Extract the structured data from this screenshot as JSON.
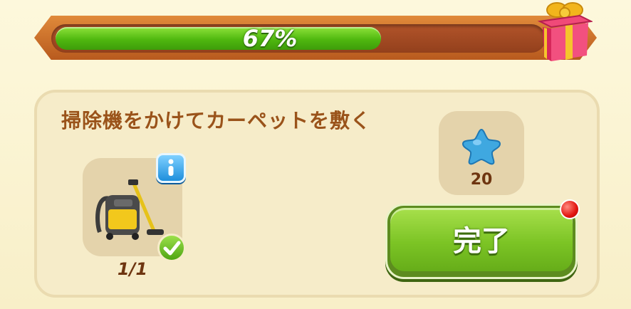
{
  "progress": {
    "percent_label": "67%",
    "fraction": 0.67,
    "fill_color": "#4fb80f"
  },
  "gift_icon": "gift-box-icon",
  "task": {
    "title": "掃除機をかけてカーペットを敷く",
    "item_icon": "vacuum-cleaner-icon",
    "item_count": "1/1",
    "info_icon": "info-icon",
    "completed_icon": "checkmark-icon"
  },
  "reward": {
    "icon": "blue-star-icon",
    "value": "20"
  },
  "done_button": {
    "label": "完了",
    "color": "#7cc425",
    "notification_icon": "red-dot-icon"
  }
}
